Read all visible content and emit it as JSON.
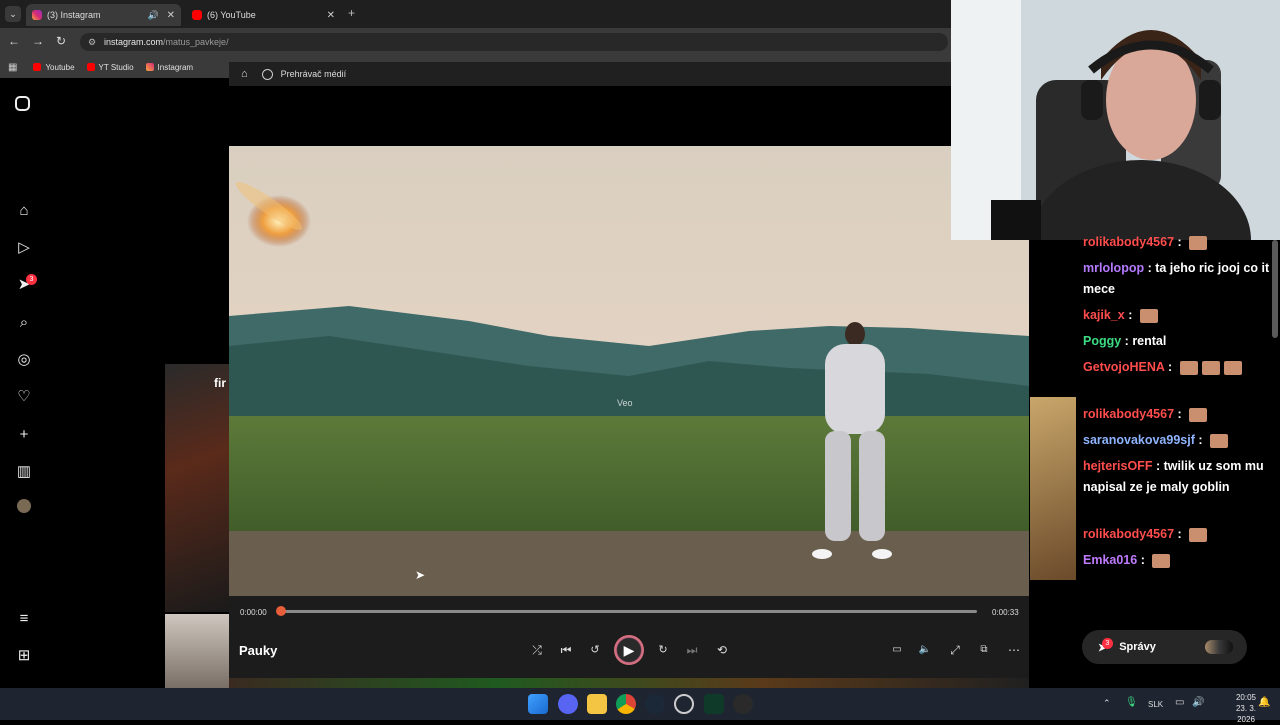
{
  "browser": {
    "tabs": [
      {
        "label": "(3) Instagram",
        "active": true
      },
      {
        "label": "(6) YouTube",
        "active": false
      }
    ],
    "url_host": "instagram.com",
    "url_path": "/matus_pavkeje/",
    "bookmarks": [
      "Youtube",
      "YT Studio",
      "Instagram"
    ]
  },
  "instagram": {
    "notification_count": "3",
    "partial_text": "fir"
  },
  "player": {
    "title": "Prehrávač médií",
    "watermark": "Veo",
    "time_current": "0:00:00",
    "time_total": "0:00:33",
    "progress": 0.0,
    "track_title": "Pauky"
  },
  "chat": {
    "messages": [
      {
        "user": "rolikabody4567",
        "color": "#ff4d4d",
        "text": ""
      },
      {
        "user": "mrlolopop",
        "color": "#b57bff",
        "text": "ta jeho ric jooj co it mece"
      },
      {
        "user": "kajik_x",
        "color": "#ff4d4d",
        "text": ""
      },
      {
        "user": "Poggy",
        "color": "#3ddc84",
        "text": "rental"
      },
      {
        "user": "GetvojoHENA",
        "color": "#ff4d4d",
        "text": ""
      },
      {
        "user": "rolikabody4567",
        "color": "#ff4d4d",
        "text": ""
      },
      {
        "user": "saranovakova99sjf",
        "color": "#8fb4ff",
        "text": ""
      },
      {
        "user": "hejterisOFF",
        "color": "#ff4d4d",
        "text": "twilik uz som mu napisal ze je maly goblin"
      },
      {
        "user": "rolikabody4567",
        "color": "#ff4d4d",
        "text": ""
      },
      {
        "user": "Emka016",
        "color": "#c07bff",
        "text": ""
      }
    ],
    "messages_button": "Správy",
    "messages_badge": "3"
  },
  "taskbar": {
    "language": "SLK",
    "time": "20:05",
    "date": "23. 3. 2026"
  }
}
